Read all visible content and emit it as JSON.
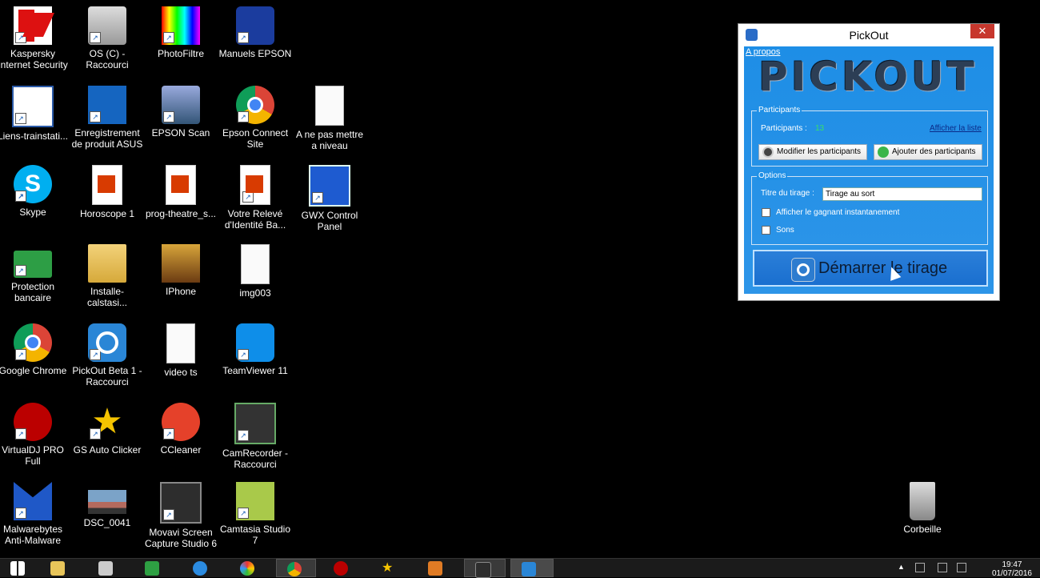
{
  "desktop": {
    "icons": [
      {
        "label": "Kaspersky Internet Security",
        "icon": "kaspersky-icon"
      },
      {
        "label": "OS (C) - Raccourci",
        "icon": "drive-icon"
      },
      {
        "label": "PhotoFiltre",
        "icon": "photofiltre-icon"
      },
      {
        "label": "Manuels EPSON",
        "icon": "epson-manual-icon"
      },
      {
        "label": "Liens-trainstati...",
        "icon": "word-doc-icon"
      },
      {
        "label": "Enregistrement de produit ASUS",
        "icon": "asus-icon"
      },
      {
        "label": "EPSON Scan",
        "icon": "scanner-icon"
      },
      {
        "label": "Epson Connect Site",
        "icon": "chrome-icon"
      },
      {
        "label": "A ne pas mettre a niveau",
        "icon": "text-doc-icon"
      },
      {
        "label": "Skype",
        "icon": "skype-icon"
      },
      {
        "label": "Horoscope 1",
        "icon": "pdf-icon"
      },
      {
        "label": "prog-theatre_s...",
        "icon": "pdf-icon"
      },
      {
        "label": "Votre Relevé d'Identité Ba...",
        "icon": "pdf-icon"
      },
      {
        "label": "GWX Control Panel",
        "icon": "gwx-icon"
      },
      {
        "label": "Protection bancaire",
        "icon": "bank-card-icon"
      },
      {
        "label": "Installe-calstasi...",
        "icon": "folder-icon"
      },
      {
        "label": "IPhone",
        "icon": "folder-icon"
      },
      {
        "label": "img003",
        "icon": "image-doc-icon"
      },
      {
        "label": "Google Chrome",
        "icon": "chrome-icon"
      },
      {
        "label": "PickOut Beta 1 - Raccourci",
        "icon": "pickout-icon"
      },
      {
        "label": "video ts",
        "icon": "text-doc-icon"
      },
      {
        "label": "TeamViewer 11",
        "icon": "teamviewer-icon"
      },
      {
        "label": "VirtualDJ PRO Full",
        "icon": "virtualdj-icon"
      },
      {
        "label": "GS Auto Clicker",
        "icon": "star-icon"
      },
      {
        "label": "CCleaner",
        "icon": "ccleaner-icon"
      },
      {
        "label": "CamRecorder - Raccourci",
        "icon": "camrecorder-icon"
      },
      {
        "label": "Malwarebytes Anti-Malware",
        "icon": "malwarebytes-icon"
      },
      {
        "label": "DSC_0041",
        "icon": "photo-icon"
      },
      {
        "label": "Movavi Screen Capture Studio 6",
        "icon": "movavi-icon"
      },
      {
        "label": "Camtasia Studio 7",
        "icon": "camtasia-icon"
      },
      {
        "label": "Corbeille",
        "icon": "recycle-bin-icon"
      }
    ]
  },
  "window": {
    "title": "PickOut",
    "close_glyph": "✕",
    "apropos": "A propos",
    "logo_text": "PICKOUT",
    "participants": {
      "legend": "Participants",
      "label": "Participants :",
      "count": "13",
      "show_list": "Afficher la liste",
      "modify_button": "Modifier les participants",
      "add_button": "Ajouter des participants"
    },
    "options": {
      "legend": "Options",
      "title_label": "Titre du tirage :",
      "title_value": "Tirage au sort",
      "show_winner": "Afficher le gagnant instantanement",
      "sounds": "Sons"
    },
    "start_button": "Démarrer le tirage"
  },
  "taskbar": {
    "clock_time": "19:47",
    "clock_date": "01/07/2016"
  },
  "colors": {
    "window_blue": "#1e8ee6",
    "participant_count": "#37e06a",
    "link": "#0b2a88"
  }
}
